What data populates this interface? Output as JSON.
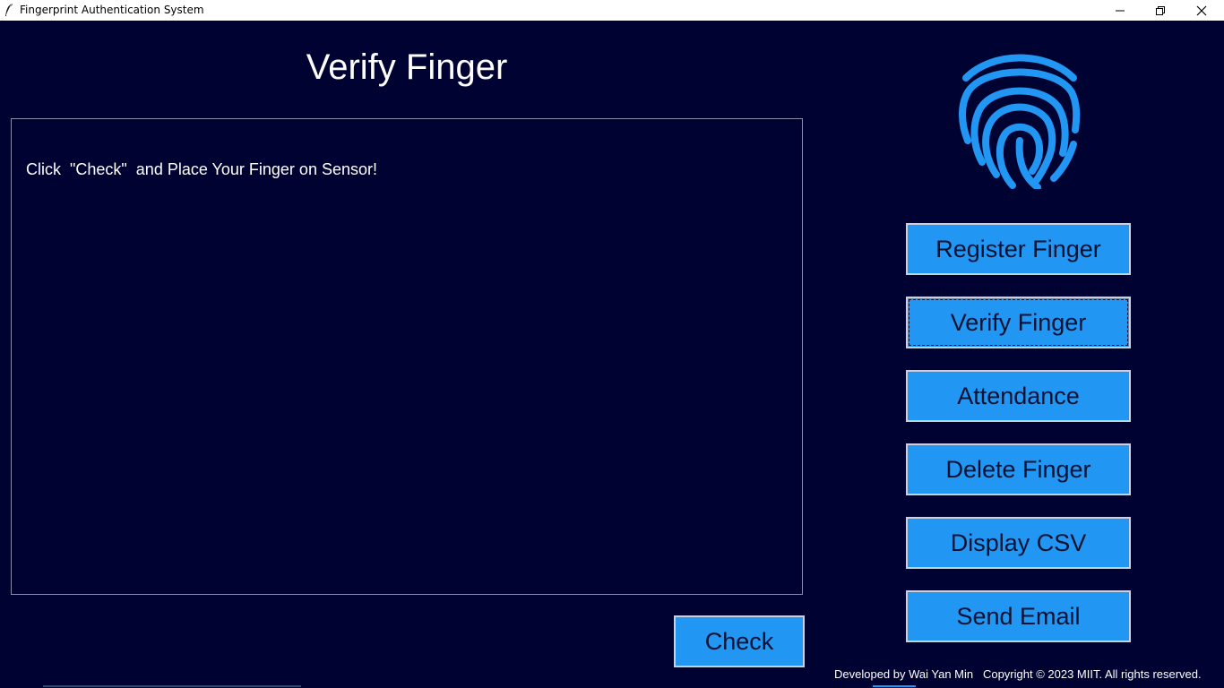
{
  "window": {
    "title": "Fingerprint Authentication System",
    "icon": "feather-icon"
  },
  "page": {
    "title": "Verify Finger",
    "output_text": "Click  \"Check\"  and Place Your Finger on Sensor!"
  },
  "logo": {
    "icon": "fingerprint-icon",
    "color": "#2196f3"
  },
  "nav": [
    {
      "label": "Register Finger"
    },
    {
      "label": "Verify Finger",
      "focused": true
    },
    {
      "label": "Attendance"
    },
    {
      "label": "Delete Finger"
    },
    {
      "label": "Display CSV"
    },
    {
      "label": "Send Email"
    }
  ],
  "check_label": "Check",
  "footer": "Developed by Wai Yan Min   Copyright © 2023 MIIT. All rights reserved.",
  "colors": {
    "background": "#000231",
    "button": "#2196f3",
    "button_text": "#0b1130"
  }
}
